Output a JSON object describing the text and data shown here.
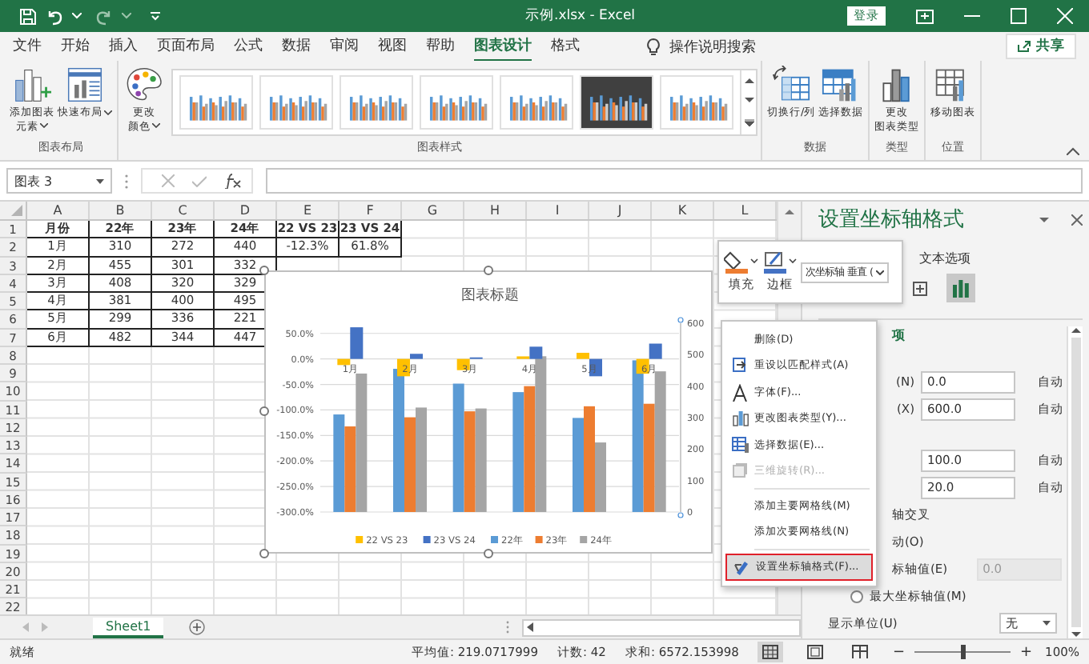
{
  "title_bar": {
    "title": "示例.xlsx  -  Excel",
    "sign_in": "登录"
  },
  "tabs": [
    {
      "label": "文件",
      "selected": false
    },
    {
      "label": "开始",
      "selected": false
    },
    {
      "label": "插入",
      "selected": false
    },
    {
      "label": "页面布局",
      "selected": false
    },
    {
      "label": "公式",
      "selected": false
    },
    {
      "label": "数据",
      "selected": false
    },
    {
      "label": "审阅",
      "selected": false
    },
    {
      "label": "视图",
      "selected": false
    },
    {
      "label": "帮助",
      "selected": false
    },
    {
      "label": "图表设计",
      "selected": true
    },
    {
      "label": "格式",
      "selected": false
    }
  ],
  "tell_me": "操作说明搜索",
  "share": "共享",
  "ribbon_groups": [
    {
      "label": "图表布局",
      "buttons": [
        {
          "kind": "add-element",
          "lines": [
            "添加图表",
            "元素"
          ],
          "dropdown": true
        },
        {
          "kind": "quick-layout",
          "lines": [
            "快速布局"
          ],
          "dropdown": true
        }
      ]
    },
    {
      "label": "图表样式",
      "buttons": [
        {
          "kind": "palette",
          "lines": [
            "更改",
            "颜色"
          ],
          "dropdown": true
        }
      ],
      "gallery": [
        {
          "kind": "light"
        },
        {
          "kind": "light"
        },
        {
          "kind": "light"
        },
        {
          "kind": "light"
        },
        {
          "kind": "light"
        },
        {
          "kind": "dark"
        },
        {
          "kind": "light"
        }
      ]
    },
    {
      "label": "数据",
      "buttons": [
        {
          "kind": "switch",
          "lines": [
            "切换行/列"
          ]
        },
        {
          "kind": "select-data",
          "lines": [
            "选择数据"
          ]
        }
      ]
    },
    {
      "label": "类型",
      "buttons": [
        {
          "kind": "change-type",
          "lines": [
            "更改",
            "图表类型"
          ]
        }
      ]
    },
    {
      "label": "位置",
      "buttons": [
        {
          "kind": "move",
          "lines": [
            "移动图表"
          ]
        }
      ]
    }
  ],
  "formula_bar": {
    "name_box": "图表 3"
  },
  "sheet": {
    "columns": [
      "A",
      "B",
      "C",
      "D",
      "E",
      "F",
      "G",
      "H",
      "I",
      "J",
      "K",
      "L"
    ],
    "rows": [
      "1",
      "2",
      "3",
      "4",
      "5",
      "6",
      "7",
      "8",
      "9",
      "10",
      "11",
      "12",
      "13",
      "14",
      "15",
      "16",
      "17",
      "18",
      "19",
      "20",
      "21",
      "22"
    ],
    "cells": [
      [
        "月份",
        "22年",
        "23年",
        "24年",
        "22 VS 23",
        "23 VS 24"
      ],
      [
        "1月",
        "310",
        "272",
        "440",
        "-12.3%",
        "61.8%"
      ],
      [
        "2月",
        "455",
        "301",
        "332"
      ],
      [
        "3月",
        "408",
        "320",
        "329"
      ],
      [
        "4月",
        "381",
        "400",
        "495"
      ],
      [
        "5月",
        "299",
        "336",
        "221"
      ],
      [
        "6月",
        "482",
        "344",
        "447"
      ]
    ]
  },
  "chart": {
    "chart_data": {
      "type": "bar",
      "title": "图表标题",
      "categories": [
        "1月",
        "2月",
        "3月",
        "4月",
        "5月",
        "6月"
      ],
      "series": [
        {
          "name": "22 VS 23",
          "color": "#ffc000",
          "values": [
            -0.12,
            -0.34,
            -0.22,
            0.05,
            0.12,
            -0.29
          ]
        },
        {
          "name": "23 VS 24",
          "color": "#4472c4",
          "values": [
            0.62,
            0.1,
            0.03,
            0.24,
            -0.34,
            0.3
          ]
        },
        {
          "name": "22年",
          "color": "#5b9bd5",
          "axis": "y2",
          "values": [
            310,
            455,
            408,
            381,
            299,
            482
          ]
        },
        {
          "name": "23年",
          "color": "#ed7d31",
          "axis": "y2",
          "values": [
            272,
            301,
            320,
            400,
            336,
            344
          ]
        },
        {
          "name": "24年",
          "color": "#a5a5a5",
          "axis": "y2",
          "values": [
            440,
            332,
            329,
            495,
            221,
            447
          ]
        }
      ],
      "ylim": [
        -3,
        0.7
      ],
      "grid": true,
      "legend": "bottom",
      "yticks": [
        {
          "value": 0.5,
          "label": "50.0%"
        },
        {
          "value": 0,
          "label": "0.0%"
        },
        {
          "value": -0.5,
          "label": "-50.0%"
        },
        {
          "value": -1,
          "label": "-100.0%"
        },
        {
          "value": -1.5,
          "label": "-150.0%"
        },
        {
          "value": -2,
          "label": "-200.0%"
        },
        {
          "value": -2.5,
          "label": "-250.0%"
        },
        {
          "value": -3,
          "label": "-300.0%"
        }
      ],
      "y2lim": [
        0,
        600
      ],
      "y2ticks": [
        0,
        100,
        200,
        300,
        400,
        500,
        600
      ]
    }
  },
  "mini_toolbar": {
    "fill": "填充",
    "outline": "边框",
    "element_select": "次坐标轴 垂直 ("
  },
  "context_menu": {
    "items": [
      {
        "kind": "plain",
        "label": "删除(D)"
      },
      {
        "kind": "reset",
        "label": "重设以匹配样式(A)"
      },
      {
        "kind": "font",
        "label": "字体(F)..."
      },
      {
        "kind": "change-type",
        "label": "更改图表类型(Y)..."
      },
      {
        "kind": "select-data",
        "label": "选择数据(E)..."
      },
      {
        "kind": "rotate",
        "label": "三维旋转(R)...",
        "disabled": true
      },
      {
        "kind": "separator"
      },
      {
        "kind": "plain",
        "label": "添加主要网格线(M)"
      },
      {
        "kind": "plain",
        "label": "添加次要网格线(N)"
      },
      {
        "kind": "separator"
      },
      {
        "kind": "format",
        "label": "设置坐标轴格式(F)...",
        "highlighted": true
      }
    ]
  },
  "format_pane": {
    "title": "设置坐标轴格式",
    "text_tab": "文本选项",
    "icons": [
      {
        "kind": "size",
        "selected": false
      },
      {
        "kind": "axis",
        "selected": true
      }
    ],
    "section": "项",
    "rows": [
      {
        "kind": "field",
        "label": "(N)",
        "value": "0.0",
        "reset": "自动"
      },
      {
        "kind": "field",
        "label": "(X)",
        "value": "600.0",
        "reset": "自动"
      },
      {
        "kind": "gap"
      },
      {
        "kind": "field",
        "value": "100.0",
        "reset": "自动"
      },
      {
        "kind": "field",
        "value": "20.0",
        "reset": "自动"
      },
      {
        "kind": "text",
        "label": "轴交叉"
      },
      {
        "kind": "text",
        "label": "动(O)"
      },
      {
        "kind": "field",
        "label": "标轴值(E)",
        "value": "0.0",
        "disabled": true
      },
      {
        "kind": "radio",
        "label": "最大坐标轴值(M)",
        "selected": false
      },
      {
        "kind": "select",
        "label": "显示单位(U)",
        "value": "无"
      }
    ]
  },
  "sheet_tabs": [
    {
      "label": "Sheet1",
      "selected": true
    }
  ],
  "status_bar": {
    "ready": "就绪",
    "average": "平均值: 219.0717999",
    "count": "计数: 42",
    "sum": "求和: 6572.153998",
    "views": [
      {
        "kind": "normal",
        "selected": true
      },
      {
        "kind": "page-layout",
        "selected": false
      },
      {
        "kind": "page-break",
        "selected": false
      }
    ],
    "zoom_out": "−",
    "zoom_in": "+",
    "zoom": {
      "level": 0.5,
      "label": "100%"
    }
  }
}
